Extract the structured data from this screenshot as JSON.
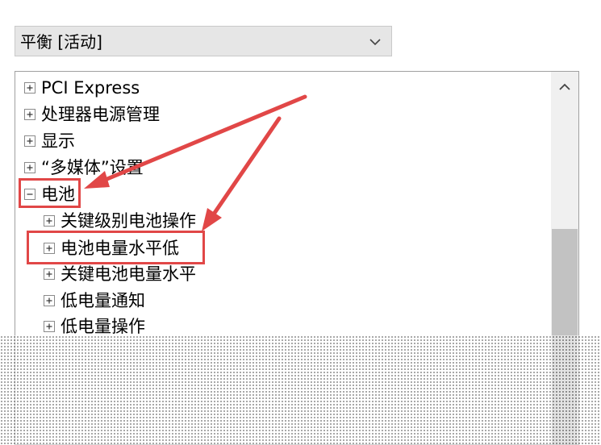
{
  "plan_select": {
    "selected": "平衡 [活动]",
    "icon": "chevron-down-icon"
  },
  "tree": {
    "items": [
      {
        "label": "PCI Express",
        "state": "collapsed"
      },
      {
        "label": "处理器电源管理",
        "state": "collapsed"
      },
      {
        "label": "显示",
        "state": "collapsed"
      },
      {
        "label": "“多媒体”设置",
        "state": "collapsed"
      },
      {
        "label": "电池",
        "state": "expanded"
      },
      {
        "label": "关键级别电池操作",
        "state": "collapsed"
      },
      {
        "label": "电池电量水平低",
        "state": "collapsed"
      },
      {
        "label": "关键电池电量水平",
        "state": "collapsed"
      },
      {
        "label": "低电量通知",
        "state": "collapsed"
      },
      {
        "label": "低电量操作",
        "state": "collapsed"
      }
    ]
  },
  "scrollbar": {
    "up_icon": "chevron-up-icon"
  },
  "annotations": {
    "color": "#e14747"
  }
}
